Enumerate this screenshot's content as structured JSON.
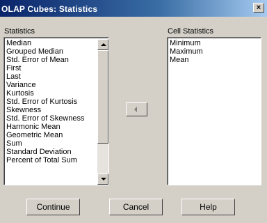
{
  "window": {
    "title": "OLAP Cubes: Statistics",
    "close_label": "×"
  },
  "statistics": {
    "label": "Statistics",
    "items": [
      "Median",
      "Grouped Median",
      "Std. Error of Mean",
      "First",
      "Last",
      "Variance",
      "Kurtosis",
      "Std. Error of Kurtosis",
      "Skewness",
      "Std. Error of Skewness",
      "Harmonic Mean",
      "Geometric Mean",
      "Sum",
      "Standard Deviation",
      "Percent of Total Sum"
    ]
  },
  "cell_statistics": {
    "label": "Cell Statistics",
    "items": [
      "Minimum",
      "Maximum",
      "Mean"
    ]
  },
  "buttons": {
    "continue": "Continue",
    "cancel": "Cancel",
    "help": "Help"
  }
}
